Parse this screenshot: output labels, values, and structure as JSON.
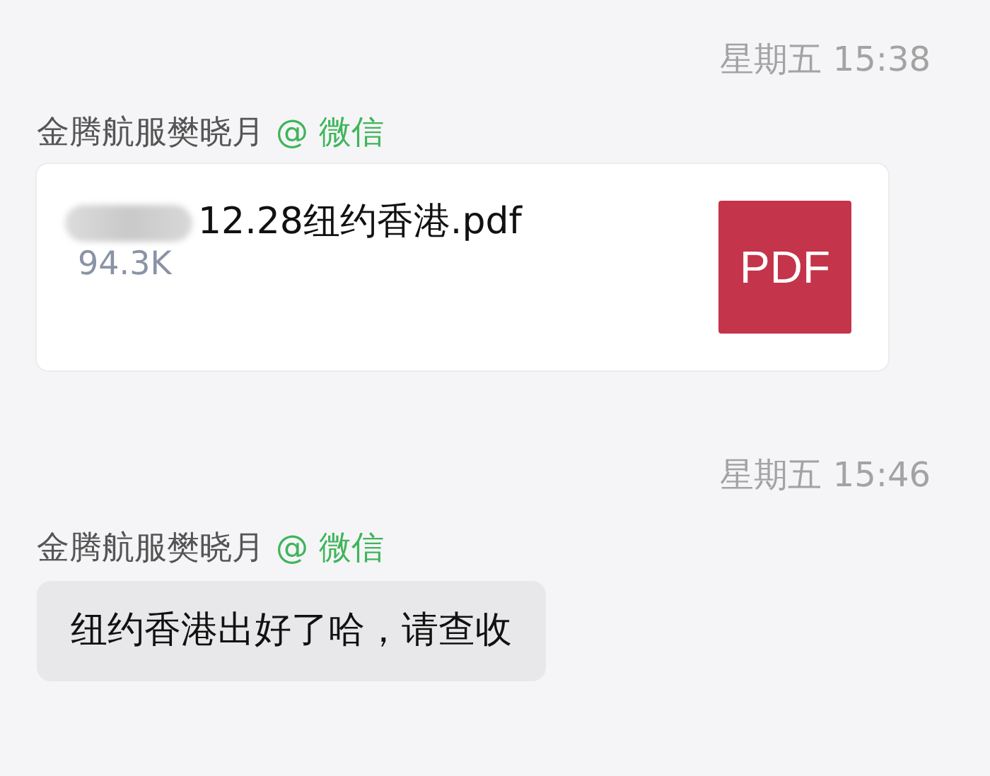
{
  "messages": [
    {
      "time": "星期五 15:38",
      "sender": "金腾航服樊晓月",
      "sender_tag": "@ 微信",
      "kind": "file",
      "file_name": "12.28纽约香港.pdf",
      "file_size": "94.3K",
      "file_type": "PDF"
    },
    {
      "time": "星期五 15:46",
      "sender": "金腾航服樊晓月",
      "sender_tag": "@ 微信",
      "kind": "text",
      "text": "纽约香港出好了哈，请查收"
    }
  ]
}
